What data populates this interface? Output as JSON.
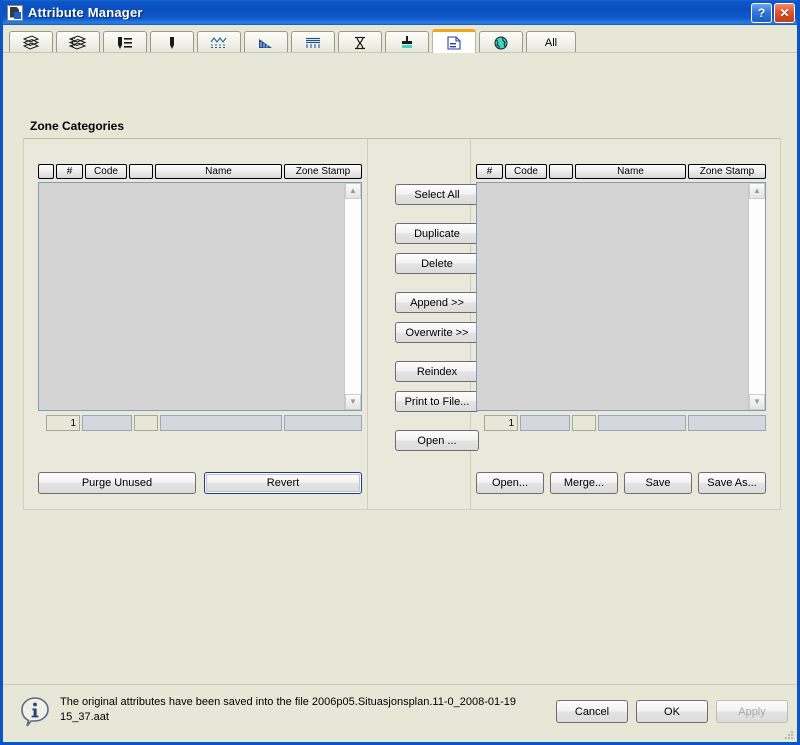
{
  "window": {
    "title": "Attribute Manager",
    "icon": "app-icon",
    "help_label": "?",
    "close_label": "✕",
    "accent": "#0b55c4",
    "active_tab_accent": "#f0a818",
    "background": "#e7e7d8"
  },
  "tabs": [
    {
      "id": "layers",
      "icon": "layers-icon",
      "label": "",
      "active": false
    },
    {
      "id": "layer-styles",
      "icon": "layers-palette-icon",
      "label": "",
      "active": false
    },
    {
      "id": "pen-list",
      "icon": "pen-list-icon",
      "label": "",
      "active": false
    },
    {
      "id": "pen",
      "icon": "pen-icon",
      "label": "",
      "active": false
    },
    {
      "id": "linetypes",
      "icon": "linetype-icon",
      "label": "",
      "active": false
    },
    {
      "id": "hatch",
      "icon": "hatch-icon",
      "label": "",
      "active": false
    },
    {
      "id": "fills",
      "icon": "fill-icon",
      "label": "",
      "active": false
    },
    {
      "id": "text-styles",
      "icon": "text-style-icon",
      "label": "",
      "active": false
    },
    {
      "id": "brush",
      "icon": "brush-icon",
      "label": "",
      "active": false
    },
    {
      "id": "zones",
      "icon": "zone-icon",
      "label": "",
      "active": true
    },
    {
      "id": "globe",
      "icon": "globe-icon",
      "label": "",
      "active": false
    },
    {
      "id": "all",
      "icon": "",
      "label": "All",
      "active": false
    }
  ],
  "main": {
    "group_title": "Zone Categories"
  },
  "left_panel": {
    "headers": [
      "",
      "#",
      "Code",
      "",
      "Name",
      "Zone Stamp"
    ],
    "rows": [],
    "edit_row": {
      "index": "1",
      "code": "",
      "flag": "",
      "name": "",
      "zone_stamp": ""
    },
    "buttons": [
      {
        "id": "purge-unused",
        "label": "Purge Unused",
        "state": "normal"
      },
      {
        "id": "revert",
        "label": "Revert",
        "state": "focus"
      }
    ],
    "scrollbar": {
      "up": "▲",
      "down": "▼"
    }
  },
  "center_buttons": [
    {
      "id": "select-all",
      "label": "Select All"
    },
    {
      "id": "duplicate",
      "label": "Duplicate"
    },
    {
      "id": "delete",
      "label": "Delete"
    },
    {
      "id": "append",
      "label": "Append >>"
    },
    {
      "id": "overwrite",
      "label": "Overwrite >>"
    },
    {
      "id": "reindex",
      "label": "Reindex"
    },
    {
      "id": "print-to-file",
      "label": "Print to File..."
    },
    {
      "id": "open",
      "label": "Open ..."
    }
  ],
  "right_panel": {
    "headers": [
      "#",
      "Code",
      "",
      "Name",
      "Zone Stamp"
    ],
    "rows": [],
    "edit_row": {
      "index": "1",
      "code": "",
      "flag": "",
      "name": "",
      "zone_stamp": ""
    },
    "buttons": [
      {
        "id": "open",
        "label": "Open...",
        "state": "normal"
      },
      {
        "id": "merge",
        "label": "Merge...",
        "state": "normal"
      },
      {
        "id": "save",
        "label": "Save",
        "state": "normal"
      },
      {
        "id": "save-as",
        "label": "Save As...",
        "state": "normal"
      }
    ],
    "scrollbar": {
      "up": "▲",
      "down": "▼"
    }
  },
  "footer": {
    "icon": "info-icon",
    "message": "The original attributes have been saved into the file 2006p05.Situasjonsplan.11-0_2008-01-19 15_37.aat",
    "buttons": [
      {
        "id": "cancel",
        "label": "Cancel",
        "state": "normal"
      },
      {
        "id": "ok",
        "label": "OK",
        "state": "normal"
      },
      {
        "id": "apply",
        "label": "Apply",
        "state": "disabled"
      }
    ]
  }
}
